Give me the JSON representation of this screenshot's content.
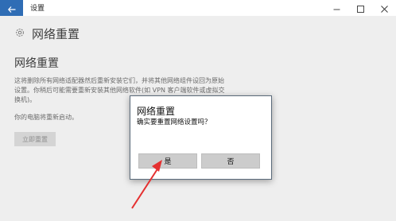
{
  "window": {
    "title": "设置",
    "back_icon": "arrow-left-icon",
    "controls": [
      "minimize-icon",
      "maximize-icon",
      "close-icon"
    ]
  },
  "page": {
    "header_icon": "gear-icon",
    "title": "网络重置",
    "section_title": "网络重置",
    "description": "这将删除所有网络适配器然后重新安装它们，并将其他网络组件设回为原始设置。你稍后可能需要重新安装其他网络软件(如 VPN 客户端软件或虚拟交换机)。",
    "restart_note": "你的电脑将重新启动。",
    "reset_button": "立即重置"
  },
  "dialog": {
    "title": "网络重置",
    "message": "确实要重置网络设置吗？",
    "yes_label": "是",
    "no_label": "否"
  },
  "colors": {
    "accent": "#2f6db5",
    "annotation_arrow": "#e53030"
  }
}
